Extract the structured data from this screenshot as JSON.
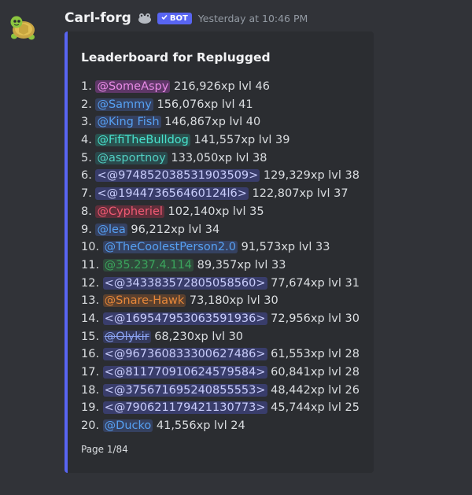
{
  "message": {
    "author": "Carl-forg",
    "bot_badge": "BOT",
    "timestamp": "Yesterday at 10:46 PM",
    "avatar_icon": "turtle-icon",
    "tag_icon": "frog-icon"
  },
  "embed": {
    "accent_color": "#5865f2",
    "title": "Leaderboard for Replugged",
    "footer": "Page 1/84",
    "rows": [
      {
        "rank": "1.",
        "name": "@SomeAspy",
        "stats": "216,926xp lvl 46"
      },
      {
        "rank": "2.",
        "name": "@Sammy",
        "stats": "156,076xp lvl 41"
      },
      {
        "rank": "3.",
        "name": "@King Fish",
        "stats": "146,867xp lvl 40"
      },
      {
        "rank": "4.",
        "name": "@FifiTheBulldog",
        "stats": "141,557xp lvl 39"
      },
      {
        "rank": "5.",
        "name": "@asportnoy",
        "stats": "133,050xp lvl 38"
      },
      {
        "rank": "6.",
        "name": "<@974852038531903509>",
        "stats": "129,329xp lvl 38"
      },
      {
        "rank": "7.",
        "name": "<@194473656460124l6>",
        "stats": "122,807xp lvl 37"
      },
      {
        "rank": "8.",
        "name": "@Cypheriel",
        "stats": "102,140xp lvl 35"
      },
      {
        "rank": "9.",
        "name": "@lea",
        "stats": "96,212xp lvl 34"
      },
      {
        "rank": "10.",
        "name": "@TheCoolestPerson2.0",
        "stats": "91,573xp lvl 33"
      },
      {
        "rank": "11.",
        "name": "@35.237.4.114",
        "stats": "89,357xp lvl 33"
      },
      {
        "rank": "12.",
        "name": "<@343383572805058560>",
        "stats": "77,674xp lvl 31"
      },
      {
        "rank": "13.",
        "name": "@Snare-Hawk",
        "stats": "73,180xp lvl 30"
      },
      {
        "rank": "14.",
        "name": "<@169547953063591936>",
        "stats": "72,956xp lvl 30"
      },
      {
        "rank": "15.",
        "name": "@Olykir",
        "stats": "68,230xp lvl 30"
      },
      {
        "rank": "16.",
        "name": "<@967360833300627486>",
        "stats": "61,553xp lvl 28"
      },
      {
        "rank": "17.",
        "name": "<@811770910624579584>",
        "stats": "60,841xp lvl 28"
      },
      {
        "rank": "18.",
        "name": "<@375671695240855553>",
        "stats": "48,442xp lvl 26"
      },
      {
        "rank": "19.",
        "name": "<@790621179421130773>",
        "stats": "45,744xp lvl 25"
      },
      {
        "rank": "20.",
        "name": "@Ducko",
        "stats": "41,556xp lvl 24"
      }
    ]
  }
}
